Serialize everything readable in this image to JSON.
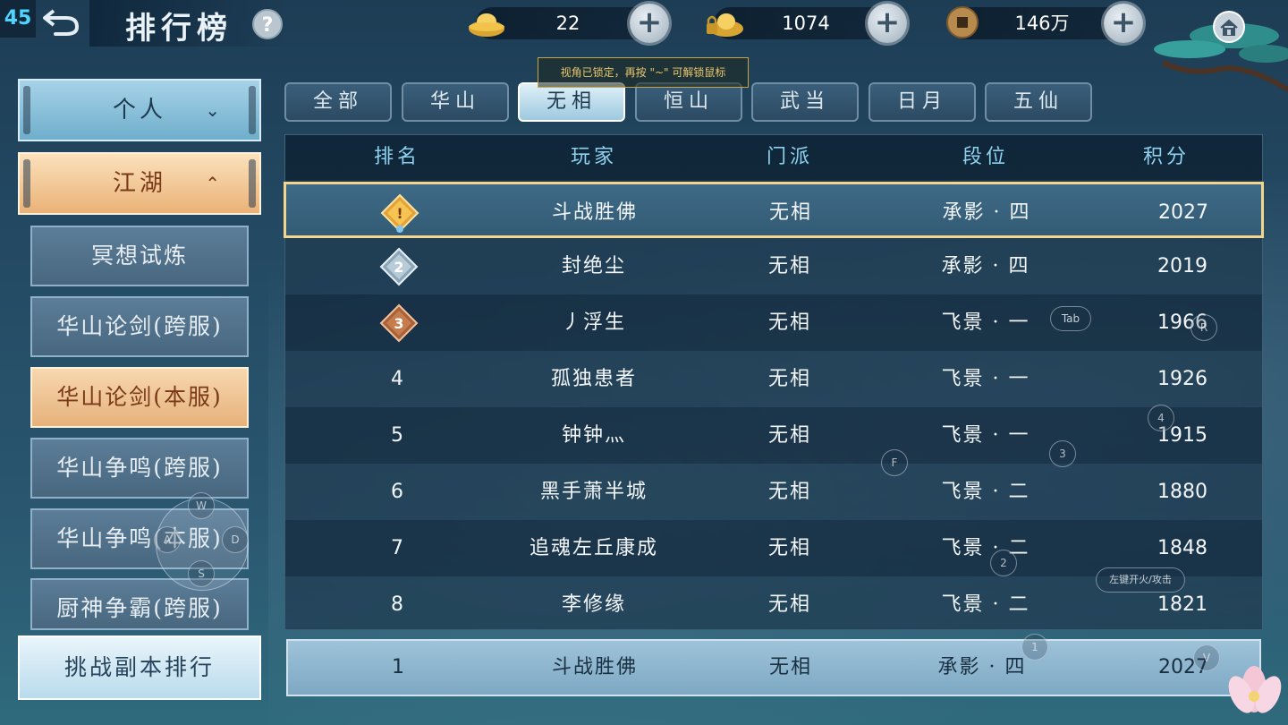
{
  "hud": {
    "fps": "45"
  },
  "header": {
    "title": "排行榜",
    "help_label": "?"
  },
  "currencies": [
    {
      "icon": "gold-ingot-icon",
      "value": "22"
    },
    {
      "icon": "bound-gold-ingot-icon",
      "value": "1074"
    },
    {
      "icon": "copper-coin-icon",
      "value": "146万"
    }
  ],
  "left_menu": {
    "personal": "个人",
    "jianghu": "江湖",
    "items": [
      "冥想试炼",
      "华山论剑(跨服)",
      "华山论剑(本服)",
      "华山争鸣(跨服)",
      "华山争鸣(本服)",
      "厨神争霸(跨服)"
    ],
    "active_index": 2,
    "challenge": "挑战副本排行"
  },
  "tooltip": "视角已锁定，再按 \"~\" 可解锁鼠标",
  "tabs": [
    "全部",
    "华山",
    "无相",
    "恒山",
    "武当",
    "日月",
    "五仙"
  ],
  "active_tab": 2,
  "table": {
    "headers": [
      "排名",
      "玩家",
      "门派",
      "段位",
      "积分"
    ],
    "rows": [
      {
        "rank": "1",
        "name": "斗战胜佛",
        "school": "无相",
        "tier": "承影 · 四",
        "score": "2027"
      },
      {
        "rank": "2",
        "name": "封绝尘",
        "school": "无相",
        "tier": "承影 · 四",
        "score": "2019"
      },
      {
        "rank": "3",
        "name": "丿浮生",
        "school": "无相",
        "tier": "飞景 · 一",
        "score": "1966"
      },
      {
        "rank": "4",
        "name": "孤独患者",
        "school": "无相",
        "tier": "飞景 · 一",
        "score": "1926"
      },
      {
        "rank": "5",
        "name": "钟钟灬",
        "school": "无相",
        "tier": "飞景 · 一",
        "score": "1915"
      },
      {
        "rank": "6",
        "name": "黑手萧半城",
        "school": "无相",
        "tier": "飞景 · 二",
        "score": "1880"
      },
      {
        "rank": "7",
        "name": "追魂左丘康成",
        "school": "无相",
        "tier": "飞景 · 二",
        "score": "1848"
      },
      {
        "rank": "8",
        "name": "李修缘",
        "school": "无相",
        "tier": "飞景 · 二",
        "score": "1821"
      }
    ],
    "mine": {
      "rank": "1",
      "name": "斗战胜佛",
      "school": "无相",
      "tier": "承影 · 四",
      "score": "2027"
    }
  },
  "key_hints": {
    "tab": "Tab",
    "r": "R",
    "f": "F",
    "n4": "4",
    "n3": "3",
    "n2": "2",
    "n1": "1",
    "v": "V",
    "w": "W",
    "a": "A",
    "s": "S",
    "d": "D",
    "attack": "左键开火/攻击"
  },
  "colors": {
    "header_text": "#8fd2f0",
    "highlight_border": "#f3d58d",
    "active_menu": "#e6b17a"
  }
}
